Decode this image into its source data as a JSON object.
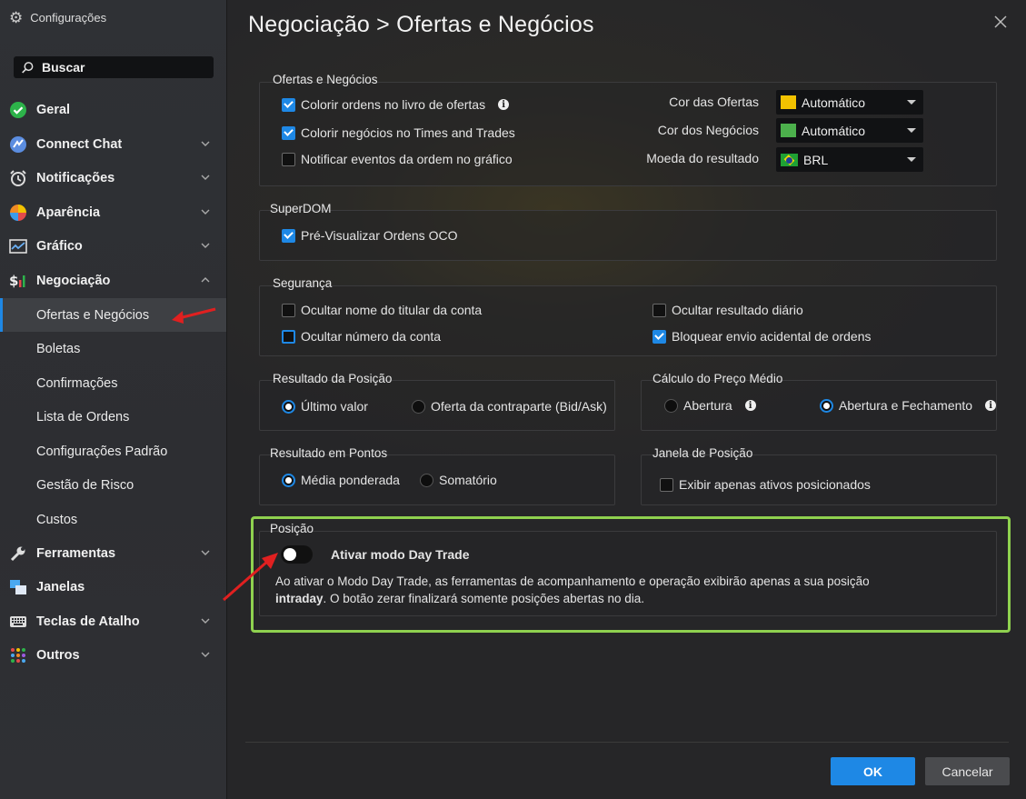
{
  "window": {
    "title": "Configurações"
  },
  "search": {
    "placeholder": "Buscar"
  },
  "sidebar": {
    "items": [
      {
        "label": "Geral",
        "icon": "check-circle-icon"
      },
      {
        "label": "Connect Chat",
        "icon": "chat-icon"
      },
      {
        "label": "Notificações",
        "icon": "alarm-clock-icon"
      },
      {
        "label": "Aparência",
        "icon": "color-wheel-icon"
      },
      {
        "label": "Gráfico",
        "icon": "chart-icon"
      },
      {
        "label": "Negociação",
        "icon": "dollar-bars-icon"
      },
      {
        "label": "Ferramentas",
        "icon": "wrench-icon"
      },
      {
        "label": "Janelas",
        "icon": "windows-icon"
      },
      {
        "label": "Teclas de Atalho",
        "icon": "keyboard-icon"
      },
      {
        "label": "Outros",
        "icon": "grid-dots-icon"
      }
    ],
    "subitems": [
      "Ofertas e Negócios",
      "Boletas",
      "Confirmações",
      "Lista de Ordens",
      "Configurações Padrão",
      "Gestão de Risco",
      "Custos"
    ],
    "active_subitem": "Ofertas e Negócios"
  },
  "page": {
    "title": "Negociação > Ofertas e Negócios"
  },
  "ofertas": {
    "title": "Ofertas e Negócios",
    "checks": [
      {
        "label": "Colorir ordens no livro de ofertas",
        "checked": true
      },
      {
        "label": "Colorir negócios no Times and Trades",
        "checked": true
      },
      {
        "label": "Notificar eventos da ordem no gráfico",
        "checked": false
      }
    ],
    "fields": [
      {
        "label": "Cor das Ofertas",
        "value": "Automático",
        "swatch": "#f2c200"
      },
      {
        "label": "Cor dos Negócios",
        "value": "Automático",
        "swatch": "#4cb04c"
      },
      {
        "label": "Moeda do resultado",
        "value": "BRL",
        "swatch": "brazil-flag-icon"
      }
    ]
  },
  "superdom": {
    "title": "SuperDOM",
    "checks": [
      {
        "label": "Pré-Visualizar Ordens OCO",
        "checked": true
      }
    ]
  },
  "seguranca": {
    "title": "Segurança",
    "checks": [
      {
        "label": "Ocultar nome do titular da conta",
        "checked": false
      },
      {
        "label": "Ocultar número da conta",
        "checked": false
      },
      {
        "label": "Ocultar resultado diário",
        "checked": false
      },
      {
        "label": "Bloquear envio acidental de ordens",
        "checked": true
      }
    ]
  },
  "resultado_posicao": {
    "title": "Resultado da Posição",
    "options": [
      "Último valor",
      "Oferta da contraparte (Bid/Ask)"
    ],
    "selected": "Último valor"
  },
  "preco_medio": {
    "title": "Cálculo do Preço Médio",
    "options": [
      "Abertura",
      "Abertura e Fechamento"
    ],
    "selected": "Abertura e Fechamento"
  },
  "resultado_pontos": {
    "title": "Resultado em Pontos",
    "options": [
      "Média ponderada",
      "Somatório"
    ],
    "selected": "Média ponderada"
  },
  "janela_posicao": {
    "title": "Janela de Posição",
    "checks": [
      {
        "label": "Exibir apenas ativos posicionados",
        "checked": false
      }
    ]
  },
  "posicao": {
    "title": "Posição",
    "toggle_label": "Ativar modo Day Trade",
    "toggle_on": false,
    "desc_line1": "Ao ativar o Modo Day Trade, as ferramentas de acompanhamento e operação exibirão apenas a sua posição",
    "desc_bold": "intraday",
    "desc_rest": ". O botão zerar finalizará somente posições abertas no dia."
  },
  "footer": {
    "ok_label": "OK",
    "cancel_label": "Cancelar"
  },
  "colors": {
    "accent": "#1e88e5",
    "highlight": "#8fd14f",
    "annotation_arrow": "#e02020"
  }
}
